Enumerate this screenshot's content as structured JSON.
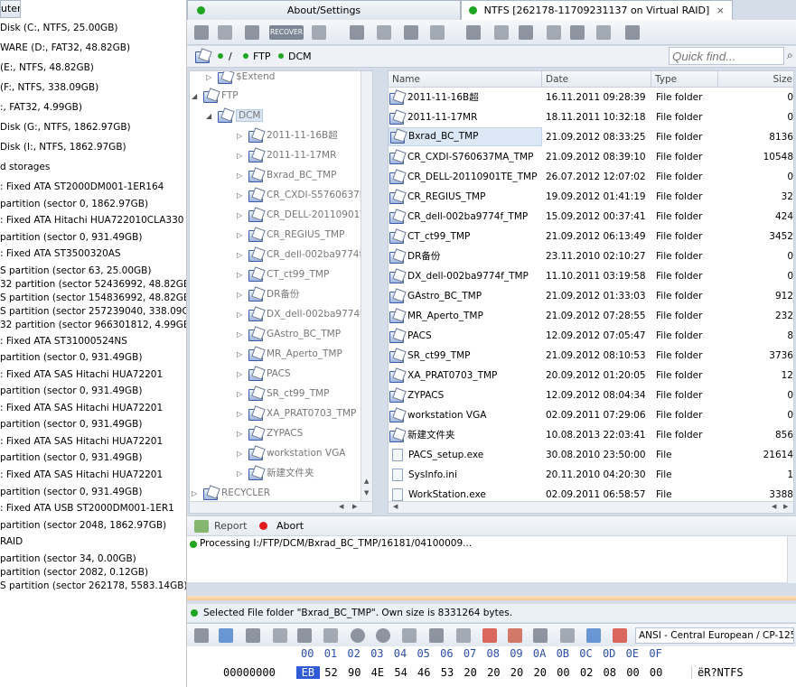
{
  "left_panel": {
    "header": "uter",
    "rows": [
      "Disk (C:, NTFS, 25.00GB)",
      "WARE (D:, FAT32, 48.82GB)",
      "(E:, NTFS, 48.82GB)",
      "(F:, NTFS, 338.09GB)",
      ":, FAT32, 4.99GB)",
      "Disk (G:, NTFS, 1862.97GB)",
      "Disk (I:, NTFS, 1862.97GB)",
      "d storages",
      ": Fixed ATA ST2000DM001-1ER164",
      " partition (sector 0, 1862.97GB)",
      ": Fixed ATA Hitachi HUA722010CLA330",
      " partition (sector 0, 931.49GB)",
      ": Fixed ATA ST3500320AS",
      "S partition (sector 63, 25.00GB)",
      "32 partition (sector 52436992, 48.82GB)",
      "S partition (sector 154836992, 48.82GB)",
      "S partition (sector 257239040, 338.09GB)",
      "32 partition (sector 966301812, 4.99GB)",
      ": Fixed ATA ST31000524NS",
      " partition (sector 0, 931.49GB)",
      ": Fixed ATA SAS Hitachi HUA72201",
      " partition (sector 0, 931.49GB)",
      ": Fixed ATA SAS Hitachi HUA72201",
      " partition (sector 0, 931.49GB)",
      ": Fixed ATA SAS Hitachi HUA72201",
      " partition (sector 0, 931.49GB)",
      ": Fixed ATA SAS Hitachi HUA72201",
      " partition (sector 0, 931.49GB)",
      ": Fixed ATA USB ST2000DM001-1ER1",
      " partition (sector 2048, 1862.97GB)",
      " RAID",
      " partition (sector 34, 0.00GB)",
      " partition (sector 2082, 0.12GB)",
      "S partition (sector 262178, 5583.14GB)"
    ]
  },
  "tabs": [
    {
      "label": "About/Settings",
      "active": false
    },
    {
      "label": "NTFS [262178-11709231137 on Virtual RAID]",
      "active": true,
      "close": "×"
    }
  ],
  "toolbar": {
    "recover_label": "RECOVER"
  },
  "path": {
    "root": "/",
    "parts": [
      "FTP",
      "DCM"
    ]
  },
  "quick_find": {
    "placeholder": "Quick find..."
  },
  "tree": {
    "items": [
      {
        "label": "$Extend",
        "level": 2
      },
      {
        "label": "FTP",
        "level": 1,
        "expanded": true
      },
      {
        "label": "DCM",
        "level": 2,
        "expanded": true,
        "selected": true
      },
      {
        "label": "2011-11-16B超",
        "level": 3
      },
      {
        "label": "2011-11-17MR",
        "level": 3
      },
      {
        "label": "Bxrad_BC_TMP",
        "level": 3
      },
      {
        "label": "CR_CXDI-S5760637MA_T",
        "level": 3
      },
      {
        "label": "CR_DELL-20110901TE_",
        "level": 3
      },
      {
        "label": "CR_REGIUS_TMP",
        "level": 3
      },
      {
        "label": "CR_dell-002ba9774f_T",
        "level": 3
      },
      {
        "label": "CT_ct99_TMP",
        "level": 3
      },
      {
        "label": "DR备份",
        "level": 3
      },
      {
        "label": "DX_dell-002ba9774f_TM",
        "level": 3
      },
      {
        "label": "GAstro_BC_TMP",
        "level": 3
      },
      {
        "label": "MR_Aperto_TMP",
        "level": 3
      },
      {
        "label": "PACS",
        "level": 3
      },
      {
        "label": "SR_ct99_TMP",
        "level": 3
      },
      {
        "label": "XA_PRAT0703_TMP",
        "level": 3
      },
      {
        "label": "ZYPACS",
        "level": 3
      },
      {
        "label": "workstation VGA",
        "level": 3
      },
      {
        "label": "新建文件夹",
        "level": 3
      },
      {
        "label": "RECYCLER",
        "level": 1
      }
    ]
  },
  "list": {
    "columns": [
      "Name",
      "Date",
      "Type",
      "Size"
    ],
    "rows": [
      {
        "name": "2011-11-16B超",
        "date": "16.11.2011 09:28:39",
        "type": "File folder",
        "size": "0",
        "kind": "folder"
      },
      {
        "name": "2011-11-17MR",
        "date": "18.11.2011 10:32:18",
        "type": "File folder",
        "size": "0",
        "kind": "folder"
      },
      {
        "name": "Bxrad_BC_TMP",
        "date": "21.09.2012 08:33:25",
        "type": "File folder",
        "size": "8136",
        "kind": "folder",
        "selected": true
      },
      {
        "name": "CR_CXDI-S760637MA_TMP",
        "date": "21.09.2012 08:39:10",
        "type": "File folder",
        "size": "10548",
        "kind": "folder"
      },
      {
        "name": "CR_DELL-20110901TE_TMP",
        "date": "26.07.2012 12:07:02",
        "type": "File folder",
        "size": "0",
        "kind": "folder"
      },
      {
        "name": "CR_REGIUS_TMP",
        "date": "19.09.2012 01:41:19",
        "type": "File folder",
        "size": "32",
        "kind": "folder"
      },
      {
        "name": "CR_dell-002ba9774f_TMP",
        "date": "15.09.2012 00:37:41",
        "type": "File folder",
        "size": "424",
        "kind": "folder"
      },
      {
        "name": "CT_ct99_TMP",
        "date": "21.09.2012 06:13:49",
        "type": "File folder",
        "size": "3452",
        "kind": "folder"
      },
      {
        "name": "DR备份",
        "date": "23.11.2010 02:10:27",
        "type": "File folder",
        "size": "0",
        "kind": "folder"
      },
      {
        "name": "DX_dell-002ba9774f_TMP",
        "date": "11.10.2011 03:19:58",
        "type": "File folder",
        "size": "0",
        "kind": "folder"
      },
      {
        "name": "GAstro_BC_TMP",
        "date": "21.09.2012 01:33:03",
        "type": "File folder",
        "size": "912",
        "kind": "folder"
      },
      {
        "name": "MR_Aperto_TMP",
        "date": "21.09.2012 07:28:55",
        "type": "File folder",
        "size": "232",
        "kind": "folder"
      },
      {
        "name": "PACS",
        "date": "12.09.2012 07:05:47",
        "type": "File folder",
        "size": "8",
        "kind": "folder"
      },
      {
        "name": "SR_ct99_TMP",
        "date": "21.09.2012 08:10:53",
        "type": "File folder",
        "size": "3736",
        "kind": "folder"
      },
      {
        "name": "XA_PRAT0703_TMP",
        "date": "20.09.2012 01:20:05",
        "type": "File folder",
        "size": "12",
        "kind": "folder"
      },
      {
        "name": "ZYPACS",
        "date": "12.09.2012 08:04:34",
        "type": "File folder",
        "size": "0",
        "kind": "folder"
      },
      {
        "name": "workstation VGA",
        "date": "02.09.2011 07:29:06",
        "type": "File folder",
        "size": "0",
        "kind": "folder"
      },
      {
        "name": "新建文件夹",
        "date": "10.08.2013 22:03:41",
        "type": "File folder",
        "size": "856",
        "kind": "folder"
      },
      {
        "name": "PACS_setup.exe",
        "date": "30.08.2010 23:50:00",
        "type": "File",
        "size": "21614",
        "kind": "file"
      },
      {
        "name": "SysInfo.ini",
        "date": "20.11.2010 04:20:30",
        "type": "File",
        "size": "1",
        "kind": "file"
      },
      {
        "name": "WorkStation.exe",
        "date": "02.09.2011 06:58:57",
        "type": "File",
        "size": "3388",
        "kind": "file"
      }
    ]
  },
  "actions": {
    "report_label": "Report",
    "abort_label": "Abort"
  },
  "log": {
    "line": "Processing I:/FTP/DCM/Bxrad_BC_TMP/16181/04100009..."
  },
  "selection_status": "Selected File folder \"Bxrad_BC_TMP\". Own size is 8331264 bytes.",
  "encoding": "ANSI - Central European / CP-1250",
  "hex": {
    "columns": [
      "00",
      "01",
      "02",
      "03",
      "04",
      "05",
      "06",
      "07",
      "08",
      "09",
      "0A",
      "0B",
      "0C",
      "0D",
      "0E",
      "0F"
    ],
    "offset": "00000000",
    "bytes": [
      "EB",
      "52",
      "90",
      "4E",
      "54",
      "46",
      "53",
      "20",
      "20",
      "20",
      "20",
      "00",
      "02",
      "08",
      "00",
      "00"
    ],
    "ascii": "ëR?NTFS"
  }
}
